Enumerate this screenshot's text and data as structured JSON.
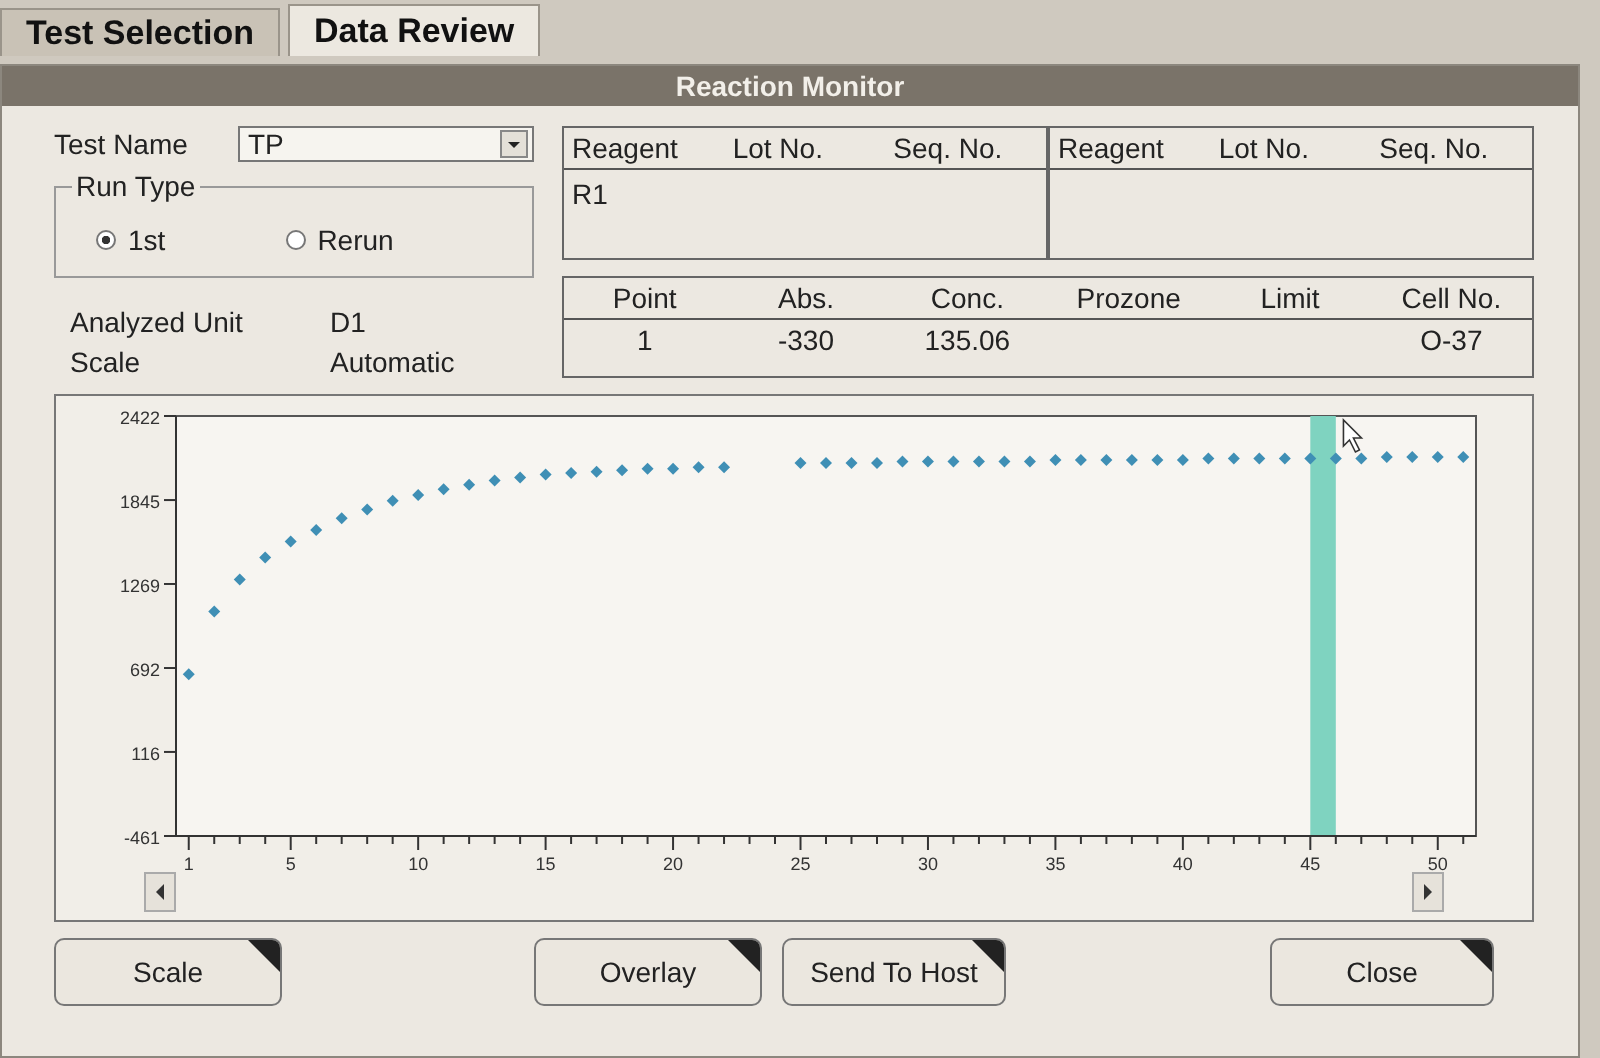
{
  "tabs": [
    {
      "label": "Test Selection",
      "selected": false
    },
    {
      "label": "Data Review",
      "selected": true
    }
  ],
  "dialog": {
    "title": "Reaction Monitor",
    "test_name": {
      "label": "Test Name",
      "value": "TP"
    },
    "run_type": {
      "label": "Run Type",
      "options": [
        {
          "label": "1st",
          "selected": true
        },
        {
          "label": "Rerun",
          "selected": false
        }
      ]
    },
    "info": [
      {
        "label": "Analyzed Unit",
        "value": "D1"
      },
      {
        "label": "Scale",
        "value": "Automatic"
      }
    ],
    "reagent_tables": [
      {
        "columns": [
          "Reagent",
          "Lot No.",
          "Seq. No."
        ],
        "rows": [
          [
            "R1"
          ]
        ]
      },
      {
        "columns": [
          "Reagent",
          "Lot No.",
          "Seq. No."
        ]
      }
    ],
    "result_table": {
      "columns": [
        "Point",
        "Abs.",
        "Conc.",
        "Prozone",
        "Limit",
        "Cell No."
      ],
      "rows": [
        {
          "point": "1",
          "abs": "-330",
          "conc": "135.06",
          "cell_no": "O-37"
        }
      ]
    },
    "chart": {
      "chart_data": {
        "type": "scatter",
        "x": [
          1,
          2,
          3,
          4,
          5,
          6,
          7,
          8,
          9,
          10,
          11,
          12,
          13,
          14,
          15,
          16,
          17,
          18,
          19,
          20,
          21,
          22,
          23,
          24,
          25,
          26,
          27,
          28,
          29,
          30,
          31,
          32,
          33,
          34,
          35,
          36,
          37,
          38,
          39,
          40,
          41,
          42,
          43,
          44,
          45,
          46,
          47,
          48,
          49,
          50,
          51
        ],
        "series": [
          {
            "color": "#3f8fb5",
            "values": [
              650,
              1080,
              1300,
              1450,
              1560,
              1640,
              1720,
              1780,
              1840,
              1880,
              1920,
              1950,
              1980,
              2000,
              2020,
              2030,
              2040,
              2050,
              2060,
              2060,
              2070,
              2070,
              null,
              null,
              2100,
              2100,
              2100,
              2100,
              2110,
              2110,
              2110,
              2110,
              2110,
              2110,
              2120,
              2120,
              2120,
              2120,
              2120,
              2120,
              2130,
              2130,
              2130,
              2130,
              2130,
              2130,
              2130,
              2140,
              2140,
              2140,
              2140
            ]
          }
        ],
        "xlim": [
          0.5,
          51.5
        ],
        "ylim": [
          -461,
          2422
        ],
        "xticks": [
          1,
          5,
          10,
          15,
          20,
          25,
          30,
          35,
          40,
          45,
          50
        ],
        "yticks": [
          -461,
          116,
          692,
          1269,
          1845,
          2422
        ],
        "bands": [
          {
            "axis": "x",
            "from": 45,
            "to": 46,
            "color": "#7fd3c0"
          }
        ]
      }
    },
    "buttons": [
      {
        "label": "Scale"
      },
      {
        "label": "Overlay"
      },
      {
        "label": "Send To Host"
      },
      {
        "label": "Close"
      }
    ]
  }
}
